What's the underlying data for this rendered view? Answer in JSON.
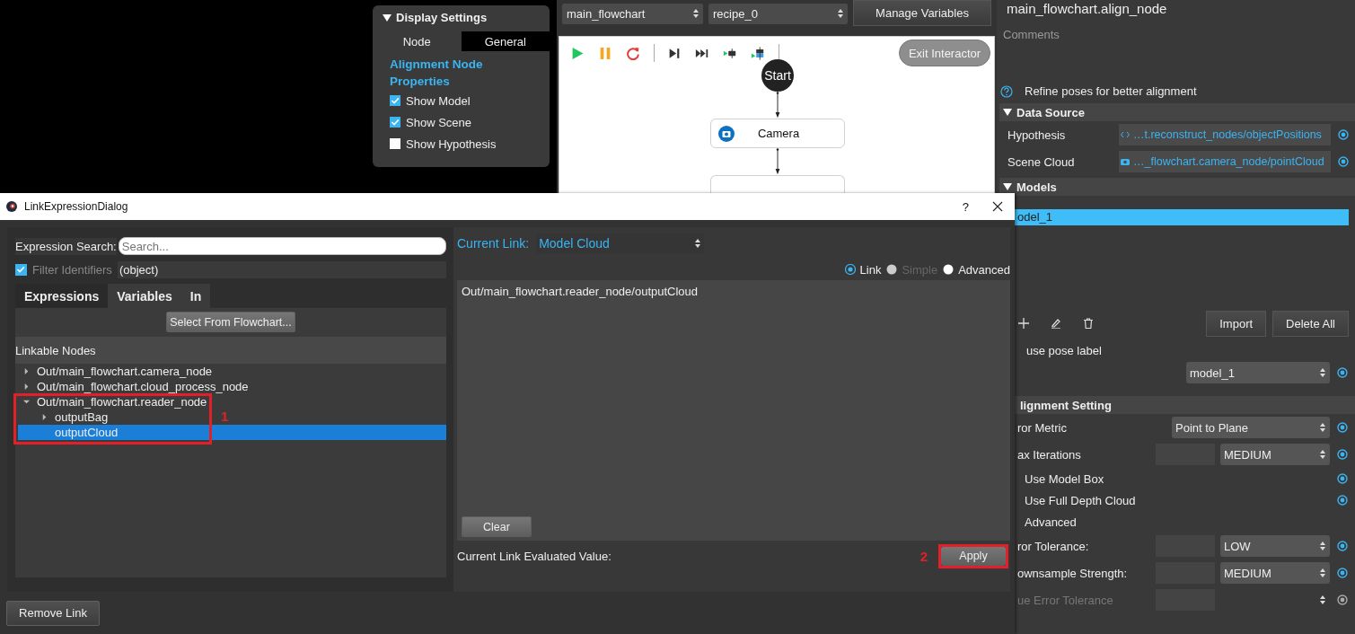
{
  "display_settings": {
    "title": "Display Settings",
    "expanded": true,
    "tabs": [
      {
        "label": "Node",
        "selected": false
      },
      {
        "label": "General",
        "selected": true
      }
    ],
    "heading": "Alignment Node Properties",
    "options": [
      {
        "label": "Show Model",
        "checked": true
      },
      {
        "label": "Show Scene",
        "checked": true
      },
      {
        "label": "Show Hypothesis",
        "checked": false
      }
    ]
  },
  "flowchart": {
    "selectors": [
      "main_flowchart",
      "recipe_0"
    ],
    "manage_button": "Manage Variables",
    "exit_button": "Exit Interactor",
    "nodes": [
      {
        "kind": "start",
        "label": "Start"
      },
      {
        "kind": "camera",
        "label": "Camera"
      },
      {
        "kind": "partial"
      }
    ]
  },
  "properties": {
    "title": "main_flowchart.align_node",
    "comments": "Comments",
    "description": "Refine poses for better alignment",
    "data_source": {
      "title": "Data Source",
      "expanded": true,
      "links": [
        {
          "label": "Hypothesis",
          "kind": "expression",
          "value": "…t.reconstruct_nodes/objectPositions"
        },
        {
          "label": "Scene Cloud",
          "kind": "camera",
          "value": "…_flowchart.camera_node/pointCloud"
        }
      ]
    },
    "models": {
      "title": "Models",
      "expanded": true,
      "items": [
        {
          "label": "odel_1",
          "selected": true
        }
      ],
      "buttons": [
        "Import",
        "Delete All"
      ],
      "pose_label": "use pose label",
      "model_select": "model_1"
    },
    "alignment": {
      "title": "lignment Setting",
      "rows": [
        {
          "kind": "select",
          "label": "ror Metric",
          "value": "Point to Plane",
          "disabled": false,
          "linked": true
        },
        {
          "kind": "field_select",
          "label": "ax Iterations",
          "value": "MEDIUM",
          "disabled": false,
          "linked": true
        },
        {
          "kind": "check",
          "label": "Use Model Box",
          "disabled": false,
          "linked": true
        },
        {
          "kind": "check",
          "label": "Use Full Depth Cloud",
          "disabled": false,
          "linked": true
        },
        {
          "kind": "check",
          "label": "Advanced",
          "disabled": false,
          "linked": false
        },
        {
          "kind": "field_select",
          "label": "ror Tolerance:",
          "value": "LOW",
          "disabled": false,
          "linked": true
        },
        {
          "kind": "field_select",
          "label": "ownsample Strength:",
          "value": "MEDIUM",
          "disabled": false,
          "linked": true
        },
        {
          "kind": "field_select",
          "label": "ue Error Tolerance",
          "disabled": true,
          "linked": true
        }
      ]
    }
  },
  "dialog": {
    "title": "LinkExpressionDialog",
    "help": "?",
    "search_label": "Expression Search:",
    "search_placeholder": "Search...",
    "filter": {
      "label": "Filter Identifiers",
      "checked": true,
      "value": "(object)"
    },
    "tabs": [
      {
        "label": "Expressions",
        "selected": true
      },
      {
        "label": "Variables",
        "selected": false
      },
      {
        "label": "In",
        "selected": false
      }
    ],
    "select_button": "Select From Flowchart...",
    "tree_header": "Linkable Nodes",
    "tree": [
      {
        "label": "Out/main_flowchart.camera_node",
        "kind": "group",
        "expanded": false,
        "selected": false
      },
      {
        "label": "Out/main_flowchart.cloud_process_node",
        "kind": "group",
        "expanded": false,
        "selected": false
      },
      {
        "label": "Out/main_flowchart.reader_node",
        "kind": "group",
        "expanded": true,
        "selected": false,
        "children": [
          {
            "label": "outputBag",
            "kind": "group",
            "expanded": false,
            "selected": false
          },
          {
            "label": "outputCloud",
            "kind": "leaf",
            "selected": true
          }
        ]
      }
    ],
    "marker_1": "1",
    "marker_2": "2",
    "current_link_label": "Current Link:",
    "current_link": "Model Cloud",
    "modes": [
      {
        "label": "Link",
        "selected": true,
        "disabled": false
      },
      {
        "label": "Simple",
        "selected": false,
        "disabled": true
      },
      {
        "label": "Advanced",
        "selected": false,
        "disabled": false
      }
    ],
    "expression": "Out/main_flowchart.reader_node/outputCloud",
    "clear_button": "Clear",
    "evaluated_label": "Current Link Evaluated Value:",
    "apply_button": "Apply",
    "remove_button": "Remove Link"
  }
}
